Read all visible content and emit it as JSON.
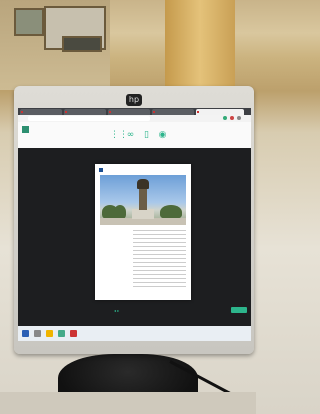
{
  "frames": [
    {
      "label": ""
    },
    {
      "label": ""
    },
    {
      "label": ""
    }
  ],
  "monitor": {
    "brand": "hp"
  },
  "browser": {
    "tabs": [
      {
        "label": "",
        "active": false
      },
      {
        "label": "",
        "active": false
      },
      {
        "label": "",
        "active": false
      },
      {
        "label": "",
        "active": false
      },
      {
        "label": "",
        "active": true
      }
    ],
    "url": ""
  },
  "toolbar": {
    "icons": [
      "grid-icon",
      "link-icon",
      "page-icon",
      "eye-icon"
    ],
    "links": [
      "",
      "",
      "",
      ""
    ]
  },
  "document": {
    "title": "",
    "caption": ""
  },
  "pager": {
    "text": "◂ ▸"
  },
  "taskbar": {
    "tray": ""
  },
  "colors": {
    "accent": "#2db58c",
    "doc_title": "#1a4d8f"
  }
}
